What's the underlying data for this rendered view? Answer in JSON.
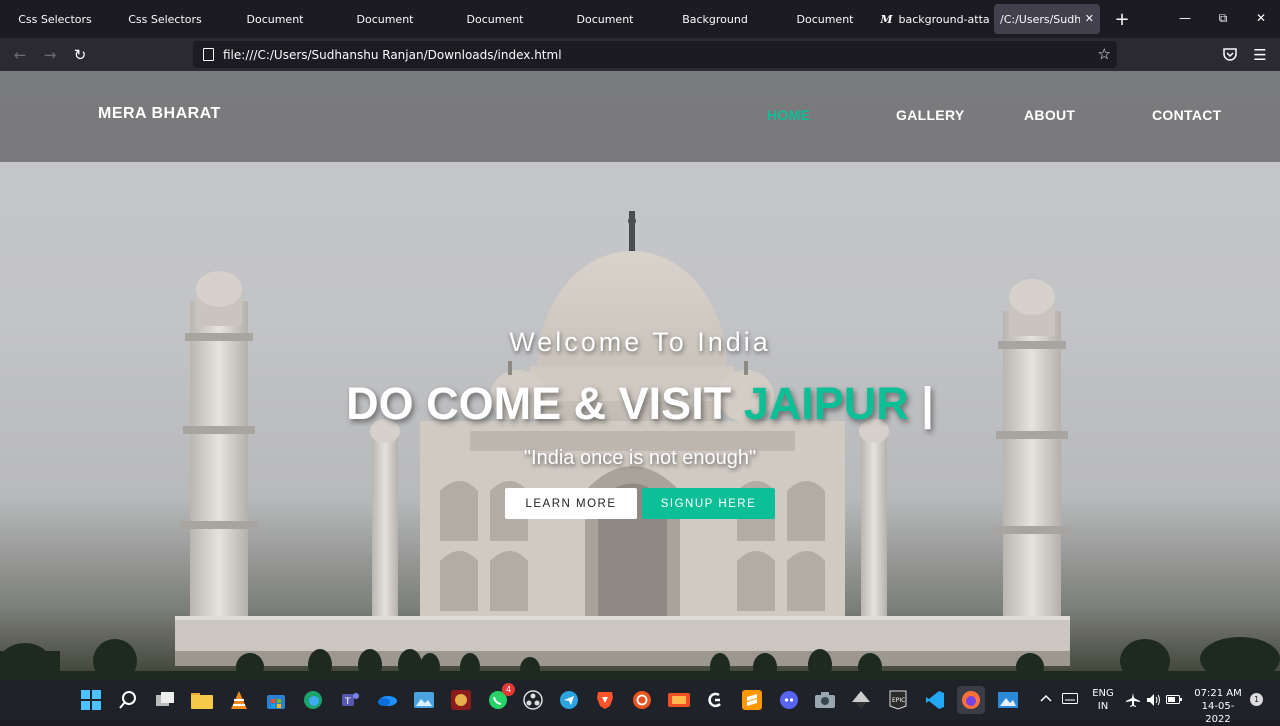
{
  "browser": {
    "tabs": [
      {
        "title": "Css Selectors"
      },
      {
        "title": "Css Selectors"
      },
      {
        "title": "Document"
      },
      {
        "title": "Document"
      },
      {
        "title": "Document"
      },
      {
        "title": "Document"
      },
      {
        "title": "Background"
      },
      {
        "title": "Document"
      },
      {
        "title": "background-atta",
        "favicon": "M"
      },
      {
        "title": "/C:/Users/Sudhans",
        "active": true
      }
    ],
    "new_tab": "+",
    "url": "file:///C:/Users/Sudhanshu Ranjan/Downloads/index.html"
  },
  "site": {
    "brand": "MERA BHARAT",
    "nav": [
      {
        "label": "HOME",
        "active": true
      },
      {
        "label": "GALLERY"
      },
      {
        "label": "ABOUT"
      },
      {
        "label": "CONTACT"
      }
    ],
    "hero": {
      "welcome": "Welcome To India",
      "headline_prefix": "DO COME & VISIT ",
      "headline_city": "JAIPUR",
      "cursor": " |",
      "tagline": "\"India once is not enough\"",
      "learn_more": "LEARN MORE",
      "signup": "SIGNUP HERE"
    },
    "accent_color": "#0dbf97"
  },
  "taskbar": {
    "whatsapp_badge": "4",
    "language_top": "ENG",
    "language_bottom": "IN",
    "time": "07:21 AM",
    "date": "14-05-2022",
    "notification_count": "1"
  }
}
